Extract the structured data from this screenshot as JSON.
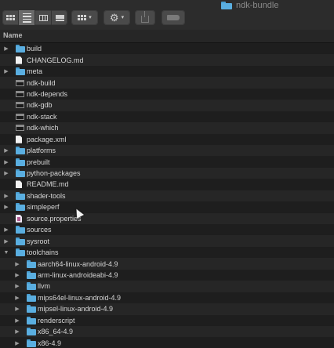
{
  "window": {
    "title": "ndk-bundle",
    "title_icon": "folder-icon"
  },
  "toolbar": {
    "view_buttons": [
      "icon-view-icon",
      "list-view-icon",
      "column-view-icon",
      "gallery-view-icon"
    ],
    "active_view": "list",
    "group_icon": "group-grid-icon",
    "action_icon": "gear-icon",
    "share_icon": "share-icon",
    "tag_icon": "tag-icon",
    "chevron": "▾"
  },
  "header": {
    "name": "Name"
  },
  "items": [
    {
      "name": "build",
      "type": "folder",
      "level": 0,
      "disclosure": "▶"
    },
    {
      "name": "CHANGELOG.md",
      "type": "document",
      "level": 0,
      "disclosure": ""
    },
    {
      "name": "meta",
      "type": "folder",
      "level": 0,
      "disclosure": "▶"
    },
    {
      "name": "ndk-build",
      "type": "executable",
      "level": 0,
      "disclosure": ""
    },
    {
      "name": "ndk-depends",
      "type": "executable",
      "level": 0,
      "disclosure": ""
    },
    {
      "name": "ndk-gdb",
      "type": "executable",
      "level": 0,
      "disclosure": ""
    },
    {
      "name": "ndk-stack",
      "type": "executable",
      "level": 0,
      "disclosure": ""
    },
    {
      "name": "ndk-which",
      "type": "executable",
      "level": 0,
      "disclosure": ""
    },
    {
      "name": "package.xml",
      "type": "document",
      "level": 0,
      "disclosure": ""
    },
    {
      "name": "platforms",
      "type": "folder",
      "level": 0,
      "disclosure": "▶"
    },
    {
      "name": "prebuilt",
      "type": "folder",
      "level": 0,
      "disclosure": "▶"
    },
    {
      "name": "python-packages",
      "type": "folder",
      "level": 0,
      "disclosure": "▶"
    },
    {
      "name": "README.md",
      "type": "document",
      "level": 0,
      "disclosure": ""
    },
    {
      "name": "shader-tools",
      "type": "folder",
      "level": 0,
      "disclosure": "▶"
    },
    {
      "name": "simpleperf",
      "type": "folder",
      "level": 0,
      "disclosure": "▶"
    },
    {
      "name": "source.properties",
      "type": "properties",
      "level": 0,
      "disclosure": ""
    },
    {
      "name": "sources",
      "type": "folder",
      "level": 0,
      "disclosure": "▶"
    },
    {
      "name": "sysroot",
      "type": "folder",
      "level": 0,
      "disclosure": "▶"
    },
    {
      "name": "toolchains",
      "type": "folder",
      "level": 0,
      "disclosure": "▼"
    },
    {
      "name": "aarch64-linux-android-4.9",
      "type": "folder",
      "level": 1,
      "disclosure": "▶"
    },
    {
      "name": "arm-linux-androideabi-4.9",
      "type": "folder",
      "level": 1,
      "disclosure": "▶"
    },
    {
      "name": "llvm",
      "type": "folder",
      "level": 1,
      "disclosure": "▶"
    },
    {
      "name": "mips64el-linux-android-4.9",
      "type": "folder",
      "level": 1,
      "disclosure": "▶"
    },
    {
      "name": "mipsel-linux-android-4.9",
      "type": "folder",
      "level": 1,
      "disclosure": "▶"
    },
    {
      "name": "renderscript",
      "type": "folder",
      "level": 1,
      "disclosure": "▶"
    },
    {
      "name": "x86_64-4.9",
      "type": "folder",
      "level": 1,
      "disclosure": "▶"
    },
    {
      "name": "x86-4.9",
      "type": "folder",
      "level": 1,
      "disclosure": "▶"
    }
  ],
  "colors": {
    "background": "#1e1e1e",
    "row_alt": "#262626",
    "folder": "#5aaee0",
    "text": "#d6d6d6"
  }
}
